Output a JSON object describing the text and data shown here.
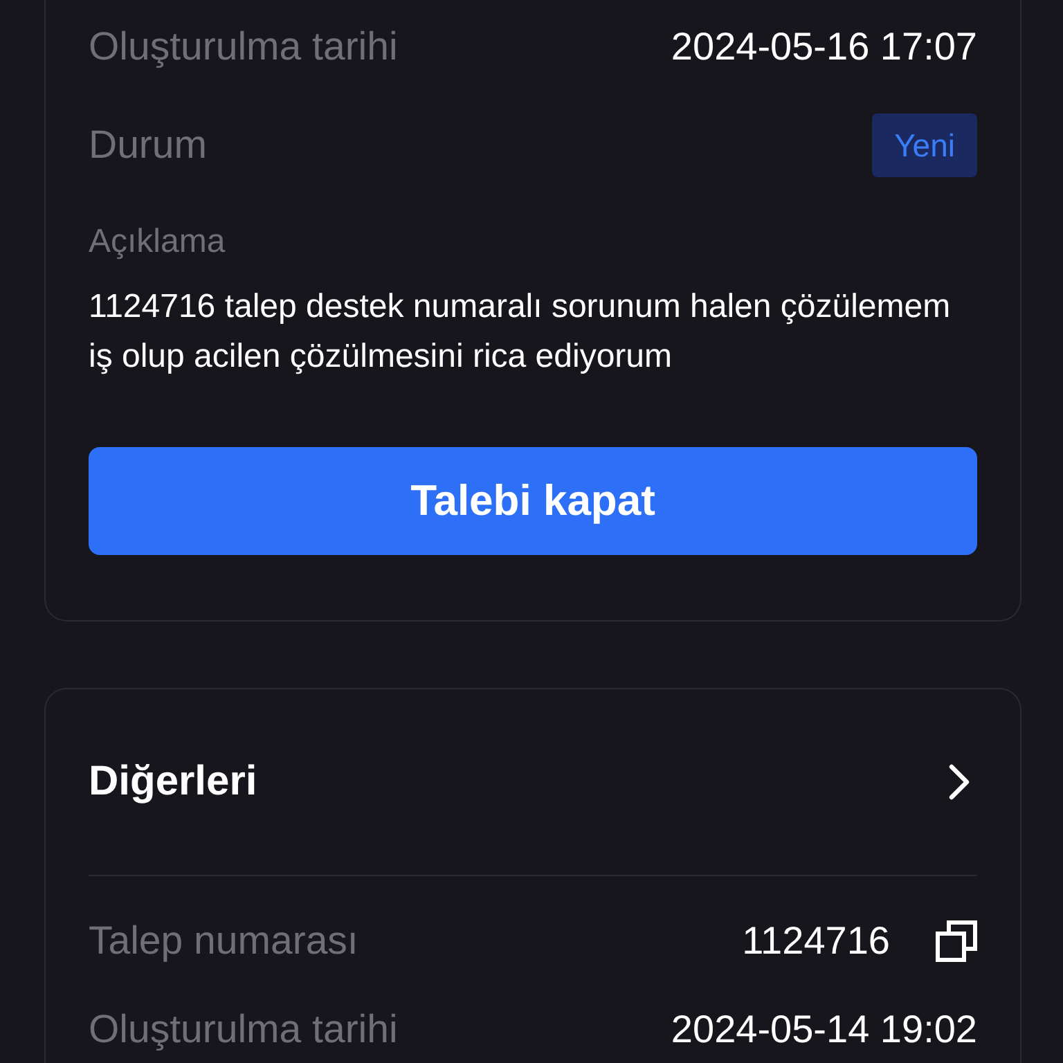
{
  "ticket": {
    "rows": [
      {
        "label": "Oluşturulma tarihi",
        "value": "2024-05-16 17:07",
        "kind": "text"
      },
      {
        "label": "Durum",
        "value": "Yeni",
        "kind": "badge"
      }
    ],
    "description": {
      "label": "Açıklama",
      "text": "1124716 talep destek numaralı sorunum halen çözülemem iş olup acilen çözülmesini rica ediyorum"
    },
    "close_button": "Talebi kapat"
  },
  "others": {
    "title": "Diğerleri",
    "rows": [
      {
        "label": "Talep numarası",
        "value": "1124716",
        "kind": "copy"
      },
      {
        "label": "Oluşturulma tarihi",
        "value": "2024-05-14 19:02",
        "kind": "text"
      }
    ]
  }
}
